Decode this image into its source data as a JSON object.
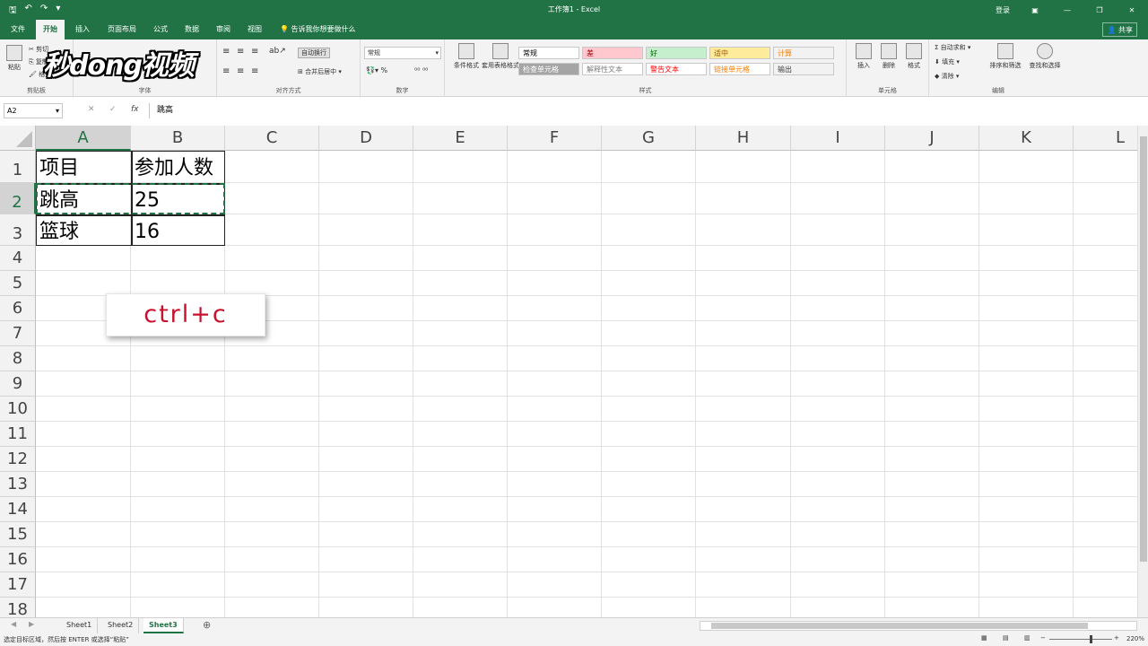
{
  "window": {
    "title": "工作簿1 - Excel",
    "login": "登录",
    "share": "共享"
  },
  "tabs": [
    "文件",
    "开始",
    "插入",
    "页面布局",
    "公式",
    "数据",
    "审阅",
    "视图"
  ],
  "tell_me": "告诉我你想要做什么",
  "ribbon": {
    "clipboard": {
      "paste": "粘贴",
      "cut": "剪切",
      "copy": "复制",
      "painter": "格式刷",
      "label": "剪贴板"
    },
    "font": {
      "label": "字体"
    },
    "alignment": {
      "wrap": "自动换行",
      "merge": "合并后居中",
      "label": "对齐方式"
    },
    "number": {
      "format": "常规",
      "label": "数字"
    },
    "styles": {
      "cond_format": "条件格式",
      "table_format": "套用表格格式",
      "label": "样式",
      "cells": [
        {
          "text": "常规",
          "bg": "#ffffff",
          "color": "#000000"
        },
        {
          "text": "差",
          "bg": "#ffc7ce",
          "color": "#9c0006"
        },
        {
          "text": "好",
          "bg": "#c6efce",
          "color": "#006100"
        },
        {
          "text": "适中",
          "bg": "#ffeb9c",
          "color": "#9c5700"
        },
        {
          "text": "计算",
          "bg": "#f2f2f2",
          "color": "#fa7d00"
        },
        {
          "text": "检查单元格",
          "bg": "#a5a5a5",
          "color": "#ffffff"
        },
        {
          "text": "解释性文本",
          "bg": "#ffffff",
          "color": "#7f7f7f"
        },
        {
          "text": "警告文本",
          "bg": "#ffffff",
          "color": "#ff0000"
        },
        {
          "text": "链接单元格",
          "bg": "#ffffff",
          "color": "#fa7d00"
        },
        {
          "text": "输出",
          "bg": "#f2f2f2",
          "color": "#3f3f3f"
        }
      ]
    },
    "cells_group": {
      "insert": "插入",
      "delete": "删除",
      "format": "格式",
      "label": "单元格"
    },
    "editing": {
      "autosum": "自动求和",
      "fill": "填充",
      "clear": "清除",
      "sort": "排序和筛选",
      "find": "查找和选择",
      "label": "编辑"
    }
  },
  "logo_text": "秒dong视频",
  "formula_bar": {
    "name_box": "A2",
    "content": "跳高"
  },
  "columns": [
    "A",
    "B",
    "C",
    "D",
    "E",
    "F",
    "G",
    "H",
    "I",
    "J",
    "K",
    "L"
  ],
  "rows": [
    "1",
    "2",
    "3",
    "4",
    "5",
    "6",
    "7",
    "8",
    "9",
    "10",
    "11",
    "12",
    "13",
    "14",
    "15",
    "16",
    "17",
    "18"
  ],
  "table": {
    "header": [
      "项目",
      "参加人数"
    ],
    "rows": [
      [
        "跳高",
        "25"
      ],
      [
        "篮球",
        "16"
      ]
    ]
  },
  "overlay": {
    "shortcut": "ctrl+c"
  },
  "sheets": [
    "Sheet1",
    "Sheet2",
    "Sheet3"
  ],
  "active_sheet": "Sheet3",
  "status": {
    "message": "选定目标区域，然后按 ENTER 或选择“粘贴”",
    "zoom": "220%"
  }
}
